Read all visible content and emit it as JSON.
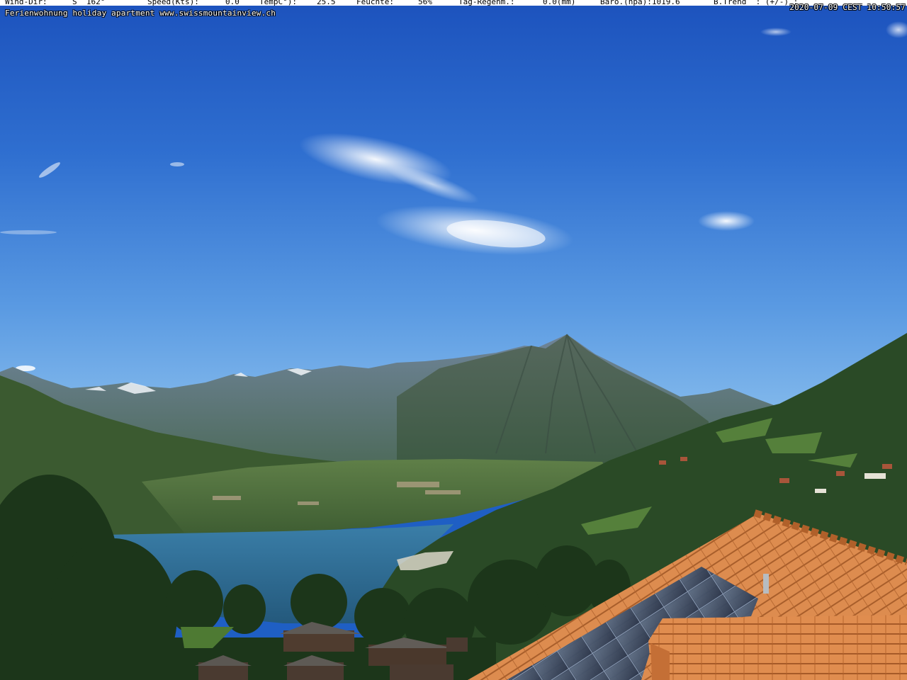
{
  "weather": {
    "wind_dir_label": "Wind-Dir:",
    "wind_dir_value": "S  162°",
    "speed_label": "Speed(Kts):",
    "speed_value": "0.0",
    "temp_label": "TempC°):",
    "temp_value": "25.5",
    "humidity_label": "Feuchte:",
    "humidity_value": "56%",
    "rain_label": "Tag-Regenm.:",
    "rain_value": "0.0(mm)",
    "baro_label": "Baro.(hpa):1019.6",
    "trend_label": "B.Trend  : (+/-) :"
  },
  "timestamp": "2020-07-09 CEST 10:50:57",
  "caption": "Ferienwohnung holiday apartment www.swissmountainview.ch",
  "colors": {
    "sky_top": "#1f5ac4",
    "sky_bottom": "#6aa6e6",
    "lake": "#2f6f9a",
    "roof": "#d98a4e",
    "solar": "#33445c",
    "forest": "#1f3a1c"
  },
  "scene": {
    "description_elements": [
      "sky",
      "clouds",
      "mountains",
      "niesen-peak",
      "lake",
      "village",
      "forest-hill",
      "trees",
      "tiled-roof",
      "solar-panels"
    ]
  }
}
